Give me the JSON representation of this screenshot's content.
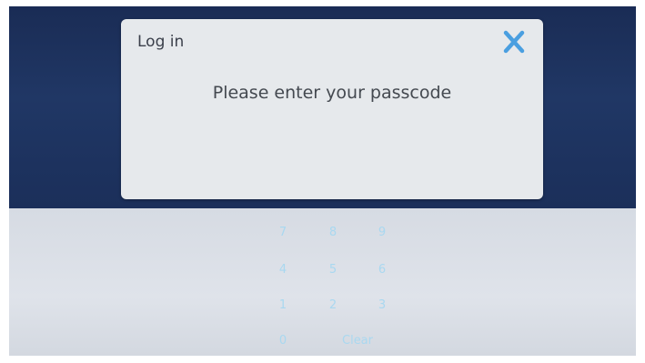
{
  "dialog": {
    "title": "Log in",
    "message": "Please enter your passcode",
    "close_icon": "close-icon",
    "passcode_value": ""
  },
  "keypad": {
    "keys": [
      "7",
      "8",
      "9",
      "4",
      "5",
      "6",
      "1",
      "2",
      "3",
      "0"
    ],
    "clear_label": "Clear"
  },
  "colors": {
    "header_background": "#203765",
    "dialog_background": "#e6e9ec",
    "close_accent": "#4a9fe0",
    "keypad_text": "#a9d8f0",
    "keypad_background": "#dfe3ea"
  }
}
